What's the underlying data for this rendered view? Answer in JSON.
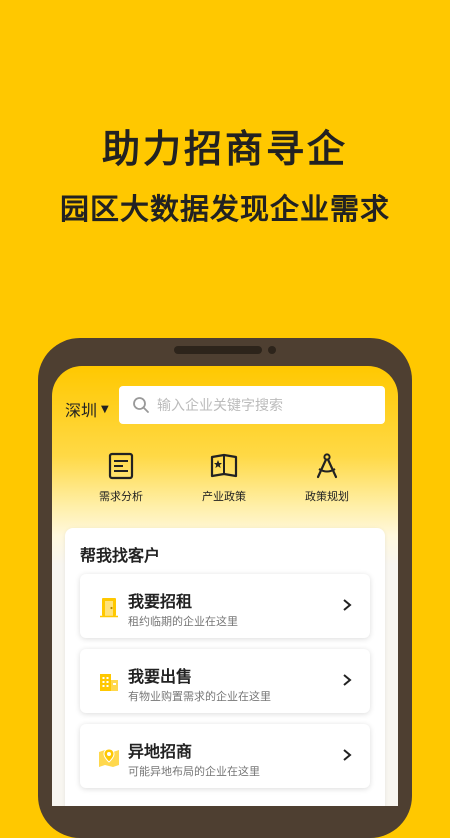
{
  "promo": {
    "headline": "助力招商寻企",
    "subheadline": "园区大数据发现企业需求"
  },
  "header": {
    "city": "深圳",
    "search_placeholder": "输入企业关键字搜索"
  },
  "quick_actions": [
    {
      "label": "需求分析",
      "icon": "report-icon"
    },
    {
      "label": "产业政策",
      "icon": "policy-book-icon"
    },
    {
      "label": "政策规划",
      "icon": "compass-icon"
    }
  ],
  "find_customers": {
    "title": "帮我找客户",
    "items": [
      {
        "title": "我要招租",
        "subtitle": "租约临期的企业在这里",
        "icon": "door-icon"
      },
      {
        "title": "我要出售",
        "subtitle": "有物业购置需求的企业在这里",
        "icon": "building-icon"
      },
      {
        "title": "异地招商",
        "subtitle": "可能异地布局的企业在这里",
        "icon": "map-pin-icon"
      }
    ]
  },
  "colors": {
    "brand_yellow": "#FFC800",
    "phone_frame": "#4E3F31",
    "text_dark": "#222222"
  }
}
